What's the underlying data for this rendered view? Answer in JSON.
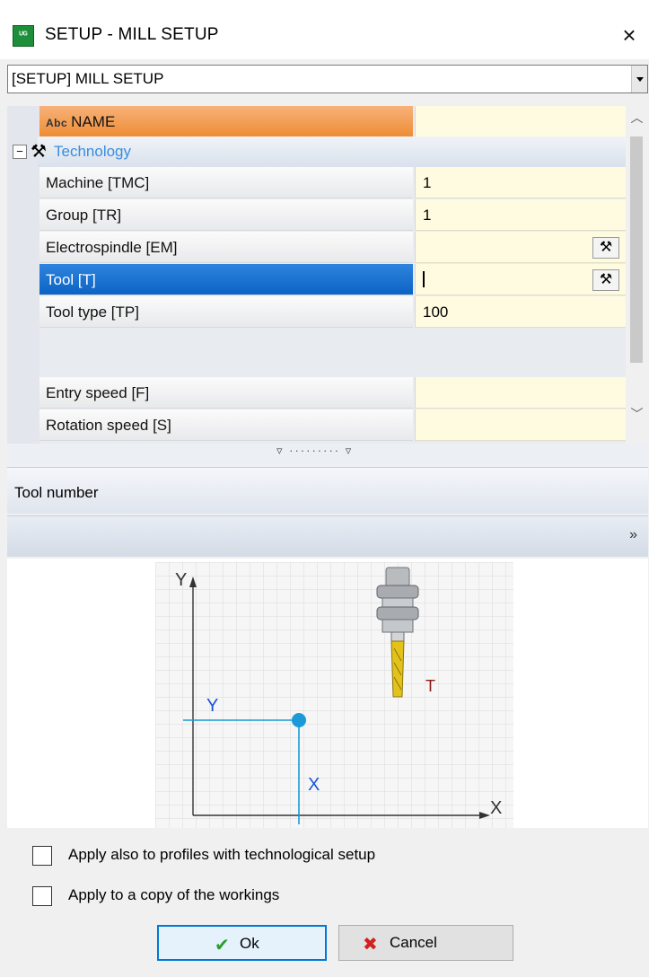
{
  "window": {
    "app_icon_text": "ᵁᴳ",
    "title": "SETUP - MILL SETUP",
    "close_glyph": "×"
  },
  "setup_combo": {
    "value": "[SETUP] MILL SETUP"
  },
  "properties": {
    "name_row": {
      "badge": "Abc",
      "label": "NAME",
      "value": ""
    },
    "group": {
      "expander": "−",
      "label": "Technology"
    },
    "rows": [
      {
        "label": "Machine [TMC]",
        "value": "1"
      },
      {
        "label": "Group [TR]",
        "value": "1"
      },
      {
        "label": "Electrospindle [EM]",
        "value": ""
      },
      {
        "label": "Tool [T]",
        "value": ""
      },
      {
        "label": "Tool type [TP]",
        "value": "100"
      },
      {
        "label": "Entry speed [F]",
        "value": ""
      },
      {
        "label": "Rotation speed [S]",
        "value": ""
      }
    ]
  },
  "description": "Tool number",
  "preview": {
    "axis_y": "Y",
    "axis_x": "X",
    "offset_y": "Y",
    "offset_x": "X",
    "tool_label": "T"
  },
  "options": {
    "apply_profiles": {
      "label": "Apply also to profiles with technological setup",
      "checked": false
    },
    "apply_copy": {
      "label": "Apply to a copy of the workings",
      "checked": false
    }
  },
  "buttons": {
    "ok": "Ok",
    "cancel": "Cancel"
  },
  "colors": {
    "selected_row": "#0c63c4",
    "name_row": "#ee8d35",
    "value_cell": "#fffbe0",
    "group_label": "#3a8ddf",
    "preview_axis": "#1a9ad6",
    "tool_label": "#8b1a1a"
  },
  "icons": {
    "tool_picker": "hammer-wrench-icon",
    "technology": "hammer-icon",
    "ok": "check-icon",
    "cancel": "x-icon",
    "expand": "double-chevron-down-icon"
  }
}
